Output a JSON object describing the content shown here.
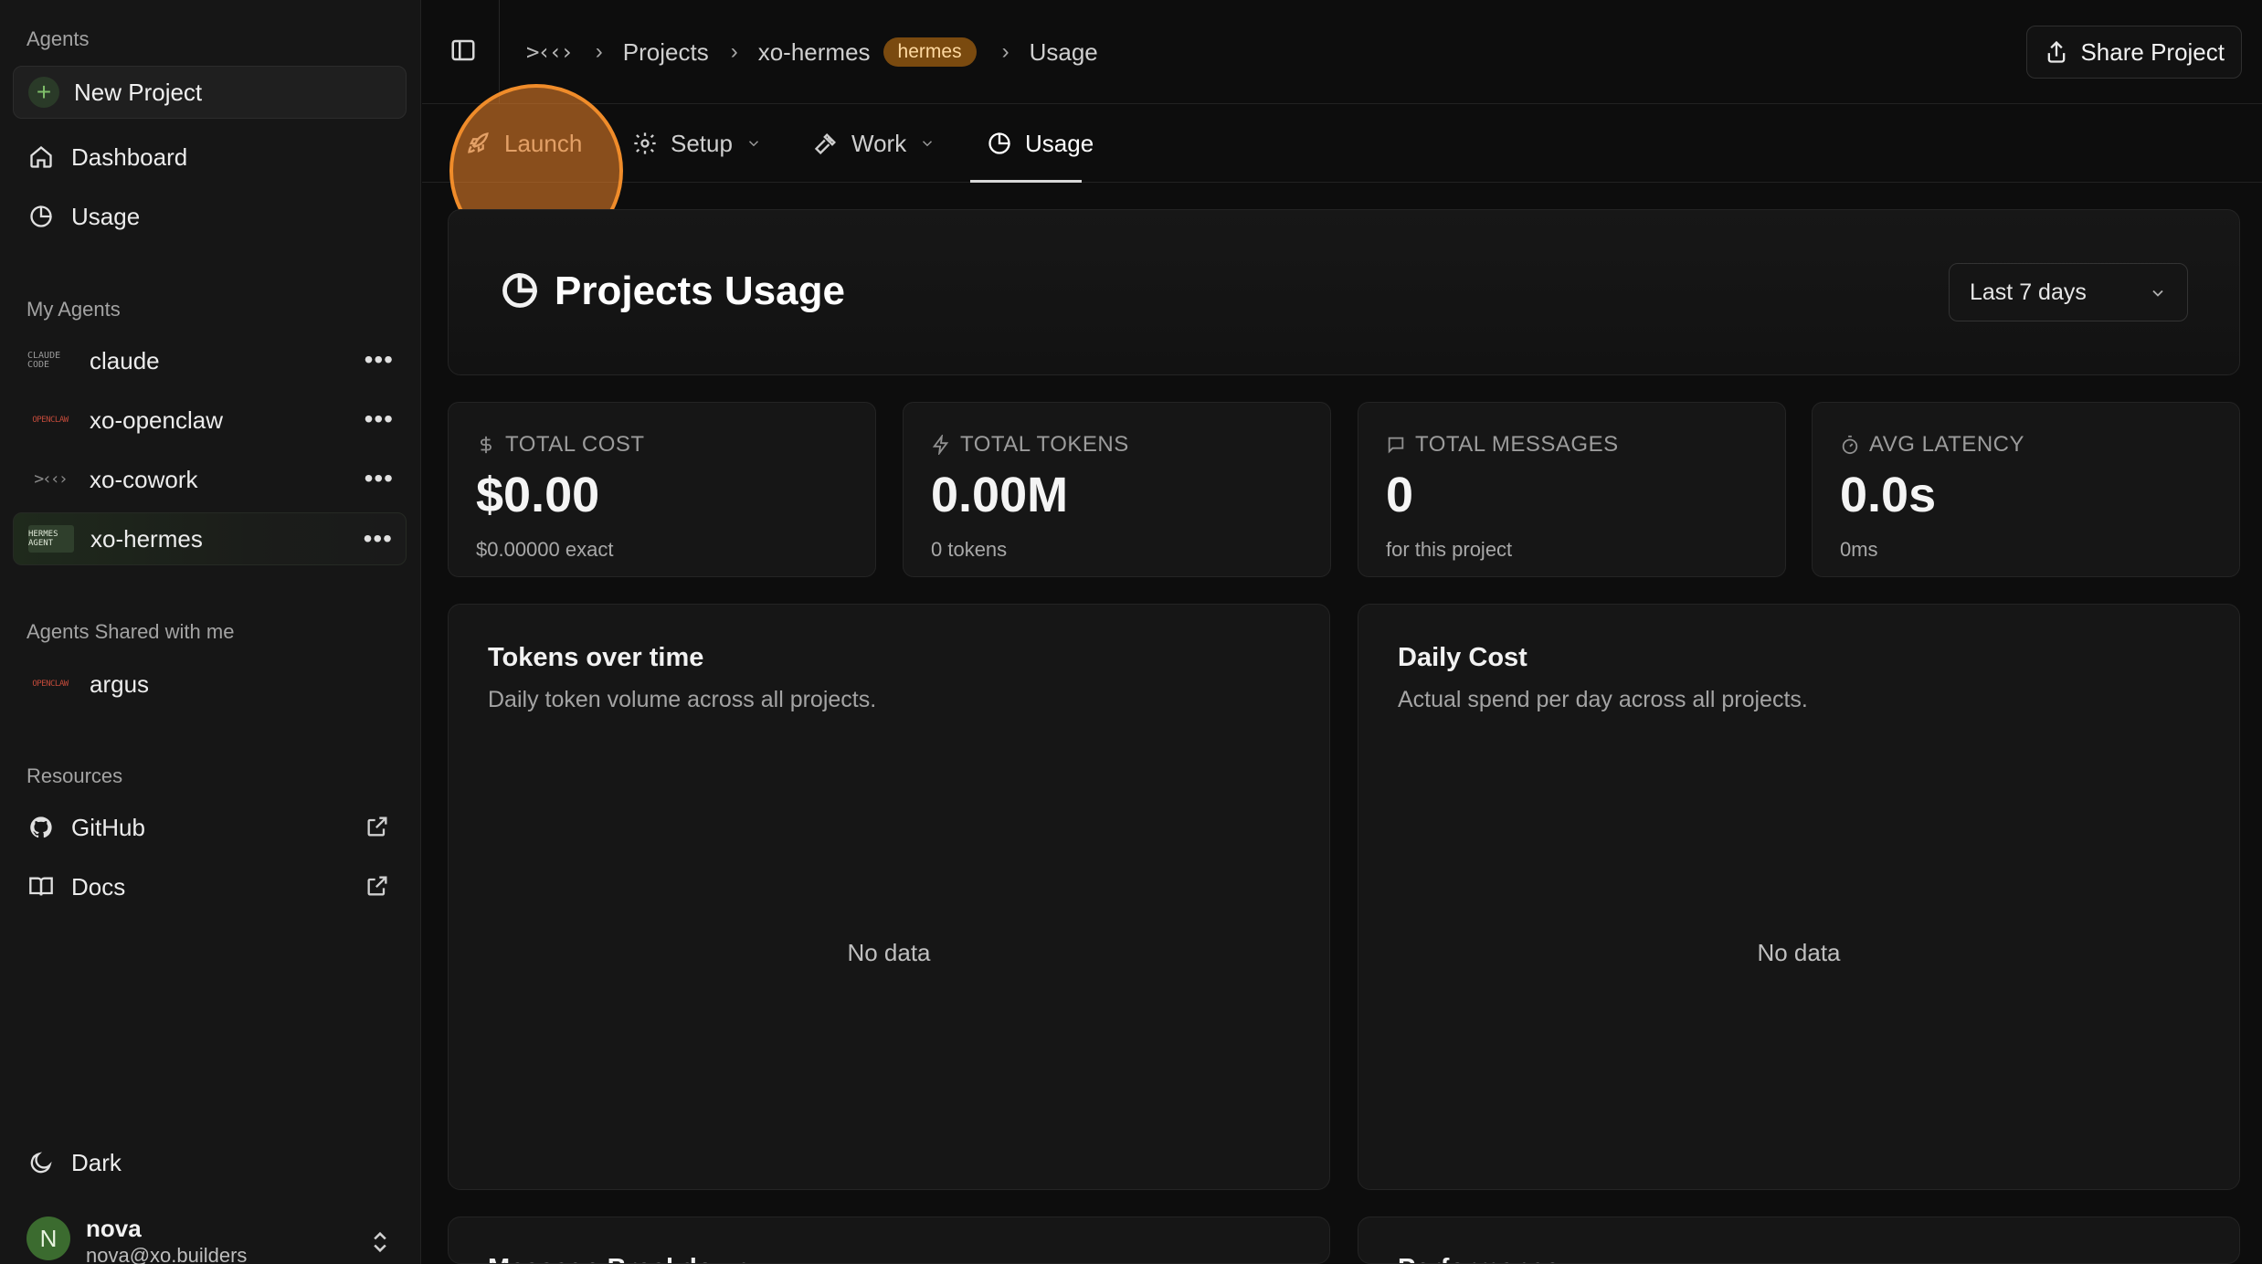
{
  "sidebar": {
    "agents_heading": "Agents",
    "new_project_label": "New Project",
    "nav": [
      {
        "label": "Dashboard",
        "icon": "home-icon"
      },
      {
        "label": "Usage",
        "icon": "pie-chart-icon"
      }
    ],
    "my_agents_heading": "My Agents",
    "my_agents": [
      {
        "label": "claude",
        "logo_text": "CLAUDE CODE"
      },
      {
        "label": "xo-openclaw",
        "logo_text": "OPENCLAW"
      },
      {
        "label": "xo-cowork",
        "logo_text": ">‹‹›"
      },
      {
        "label": "xo-hermes",
        "logo_text": "HERMES AGENT",
        "active": true
      }
    ],
    "shared_heading": "Agents Shared with me",
    "shared_agents": [
      {
        "label": "argus",
        "logo_text": "OPENCLAW"
      }
    ],
    "resources_heading": "Resources",
    "resources": [
      {
        "label": "GitHub",
        "icon": "github-icon"
      },
      {
        "label": "Docs",
        "icon": "book-icon"
      }
    ],
    "theme_label": "Dark",
    "user": {
      "initial": "N",
      "name": "nova",
      "email": "nova@xo.builders"
    }
  },
  "topbar": {
    "logo_text": ">‹‹›",
    "breadcrumbs": [
      "Projects",
      "xo-hermes",
      "Usage"
    ],
    "badge": "hermes",
    "share_label": "Share Project"
  },
  "tabs": [
    {
      "label": "Launch",
      "icon": "rocket-icon"
    },
    {
      "label": "Setup",
      "icon": "gear-icon",
      "dropdown": true
    },
    {
      "label": "Work",
      "icon": "hammer-icon",
      "dropdown": true
    },
    {
      "label": "Usage",
      "icon": "pie-chart-icon",
      "active": true
    }
  ],
  "main": {
    "title": "Projects Usage",
    "range": "Last 7 days",
    "stats": [
      {
        "label": "TOTAL COST",
        "icon": "dollar-icon",
        "value": "$0.00",
        "sub": "$0.00000 exact"
      },
      {
        "label": "TOTAL TOKENS",
        "icon": "bolt-icon",
        "value": "0.00M",
        "sub": "0 tokens"
      },
      {
        "label": "TOTAL MESSAGES",
        "icon": "message-icon",
        "value": "0",
        "sub": "for this project"
      },
      {
        "label": "AVG LATENCY",
        "icon": "timer-icon",
        "value": "0.0s",
        "sub": "0ms"
      }
    ],
    "charts": [
      {
        "title": "Tokens over time",
        "subtitle": "Daily token volume across all projects.",
        "empty": "No data"
      },
      {
        "title": "Daily Cost",
        "subtitle": "Actual spend per day across all projects.",
        "empty": "No data"
      }
    ],
    "bottom_cards": [
      "Message Breakdown",
      "Performance"
    ]
  }
}
